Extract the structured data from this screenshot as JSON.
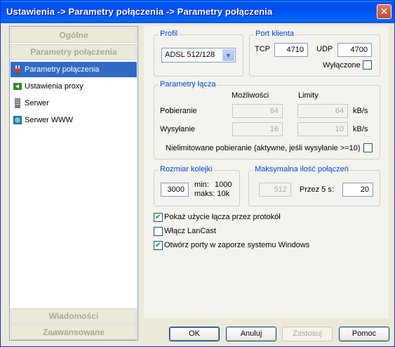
{
  "window": {
    "title": "Ustawienia -> Parametry połączenia -> Parametry połączenia",
    "close_label": "✕"
  },
  "sidebar": {
    "header_general": "Ogólne",
    "header_connection": "Parametry połączenia",
    "items": [
      {
        "label": "Parametry połączenia",
        "icon": "plug-icon",
        "selected": true
      },
      {
        "label": "Ustawienia proxy",
        "icon": "proxy-icon",
        "selected": false
      },
      {
        "label": "Serwer",
        "icon": "server-icon",
        "selected": false
      },
      {
        "label": "Serwer WWW",
        "icon": "web-server-icon",
        "selected": false
      }
    ],
    "footer_messages": "Wiadomości",
    "footer_advanced": "Zaawansowane"
  },
  "profile": {
    "legend": "Profil",
    "selected": "ADSL 512/128"
  },
  "client_port": {
    "legend": "Port klienta",
    "tcp_label": "TCP",
    "tcp_value": "4710",
    "udp_label": "UDP",
    "udp_value": "4700",
    "disabled_label": "Wyłączone",
    "disabled_checked": false
  },
  "link_params": {
    "legend": "Parametry łącza",
    "col_capacity": "Możliwości",
    "col_limits": "Limity",
    "download_label": "Pobieranie",
    "download_capacity": "64",
    "download_limit": "64",
    "upload_label": "Wysyłanie",
    "upload_capacity": "16",
    "upload_limit": "10",
    "unit": "kB/s",
    "unlimited_label": "Nielimitowane pobieranie (aktywne, jeśli wysyłanie >=10)",
    "unlimited_checked": false
  },
  "queue": {
    "legend": "Rozmiar kolejki",
    "value": "3000",
    "min_label": "min:",
    "min_value": "1000",
    "max_label": "maks: 10k"
  },
  "max_connections": {
    "legend": "Maksymalna ilość połączeń",
    "value": "512",
    "per5_label": "Przez 5 s:",
    "per5_value": "20"
  },
  "options": [
    {
      "label": "Pokaż użycie łącza przez protokół",
      "checked": true
    },
    {
      "label": "Włącz LanCast",
      "checked": false
    },
    {
      "label": "Otwórz porty w zaporze systemu Windows",
      "checked": true
    }
  ],
  "buttons": {
    "ok": "OK",
    "cancel": "Anuluj",
    "apply": "Zastosuj",
    "help": "Pomoc"
  },
  "colors": {
    "titlebar": "#0053ee",
    "selection": "#316ac5",
    "legend_text": "#0046d5",
    "check_mark": "#21a121"
  }
}
